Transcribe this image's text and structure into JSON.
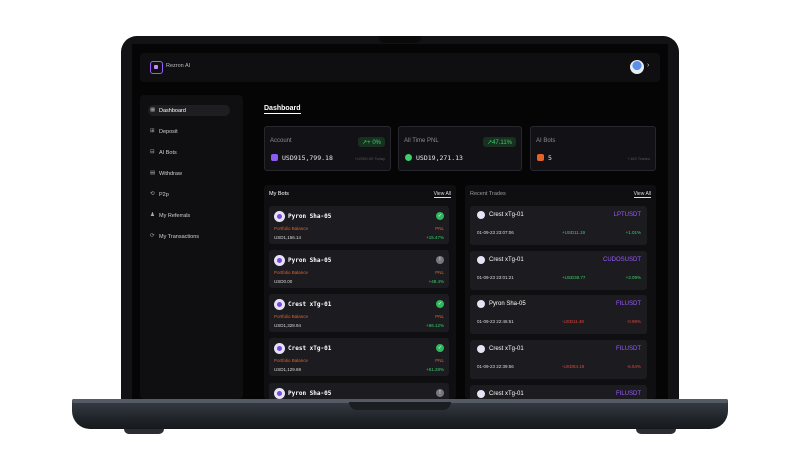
{
  "app": {
    "brand": "Rezron AI",
    "user_chevron": "›"
  },
  "sidebar": {
    "items": [
      {
        "label": "Dashboard",
        "icon": "▦"
      },
      {
        "label": "Deposit",
        "icon": "⊞"
      },
      {
        "label": "AI Bots",
        "icon": "⊟"
      },
      {
        "label": "Withdraw",
        "icon": "▤"
      },
      {
        "label": "P2p",
        "icon": "⟲"
      },
      {
        "label": "My Referrals",
        "icon": "♟"
      },
      {
        "label": "My Transactions",
        "icon": "⟳"
      }
    ]
  },
  "page": {
    "title": "Dashboard"
  },
  "stats": {
    "account": {
      "title": "Account",
      "value": "USD915,799.18",
      "badge": "↗+ 0%",
      "sub": "+USD0.00 Today"
    },
    "pnl": {
      "title": "All Time PNL",
      "value": "USD19,271.13",
      "badge": "↗47.11%"
    },
    "bots": {
      "title": "AI Bots",
      "value": "5",
      "sub": "+163 Trades"
    }
  },
  "my_bots": {
    "title": "My Bots",
    "view_all": "View All",
    "portfolio_label": "Portfolio Balance",
    "pnl_label": "PNL",
    "items": [
      {
        "name": "Pyron Sha-05",
        "balance": "USD1,156.14",
        "pct": "+15.47%",
        "status": "✓"
      },
      {
        "name": "Pyron Sha-05",
        "balance": "USD0.00",
        "pct": "+48.4%",
        "status": "!"
      },
      {
        "name": "Crest xTg-01",
        "balance": "USD1,328.94",
        "pct": "+66.12%",
        "status": "✓"
      },
      {
        "name": "Crest xTg-01",
        "balance": "USD1,129.69",
        "pct": "+61.28%",
        "status": "✓"
      },
      {
        "name": "Pyron Sha-05",
        "balance": "",
        "pct": "",
        "status": "!"
      }
    ]
  },
  "recent_trades": {
    "title": "Recent Trades",
    "view_all": "View All",
    "items": [
      {
        "bot": "Crest xTg-01",
        "pair": "LPTUSDT",
        "date": "01-09-23 23:07:06",
        "amount": "+USD11.19",
        "pct": "+1.01%"
      },
      {
        "bot": "Crest xTg-01",
        "pair": "CUDOSUSDT",
        "date": "01-09-23 23:01:21",
        "amount": "+USD38.77",
        "pct": "+3.09%"
      },
      {
        "bot": "Pyron Sha-05",
        "pair": "FILUSDT",
        "date": "01-09-23 22:46:51",
        "amount": "-USD11.48",
        "pct": "-0.99%"
      },
      {
        "bot": "Crest xTg-01",
        "pair": "FILUSDT",
        "date": "01-09-23 22:39:56",
        "amount": "-USD84.19",
        "pct": "-6.54%"
      },
      {
        "bot": "Crest xTg-01",
        "pair": "FILUSDT",
        "date": "",
        "amount": "",
        "pct": ""
      }
    ]
  },
  "colors": {
    "accent": "#9b5cff",
    "positive": "#3ecf6b",
    "negative": "#e2453c",
    "warning": "#e0642a"
  }
}
